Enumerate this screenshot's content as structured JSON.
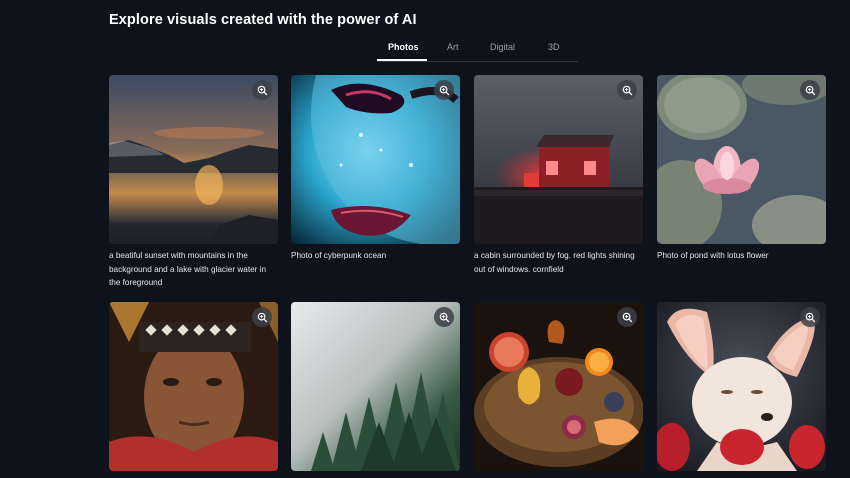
{
  "heading": "Explore visuals created with the power of AI",
  "tabs": [
    {
      "label": "Photos",
      "active": true
    },
    {
      "label": "Art",
      "active": false
    },
    {
      "label": "Digital",
      "active": false
    },
    {
      "label": "3D",
      "active": false
    }
  ],
  "gallery": [
    {
      "caption": "a beatiful sunset with mountains in the background and a lake with glacier water in the foreground",
      "icon": "zoom-in-icon"
    },
    {
      "caption": "Photo of cyberpunk ocean",
      "icon": "zoom-in-icon"
    },
    {
      "caption": "a cabin surrounded by fog. red lights shining out of windows. cornfield",
      "icon": "zoom-in-icon"
    },
    {
      "caption": "Photo of pond with lotus flower",
      "icon": "zoom-in-icon"
    },
    {
      "caption": "",
      "icon": "zoom-in-icon"
    },
    {
      "caption": "",
      "icon": "zoom-in-icon"
    },
    {
      "caption": "",
      "icon": "zoom-in-icon"
    },
    {
      "caption": "",
      "icon": "zoom-in-icon"
    }
  ],
  "colors": {
    "background": "#0e121a",
    "tab_active": "#ffffff",
    "tab_inactive": "#9aa1ad"
  }
}
